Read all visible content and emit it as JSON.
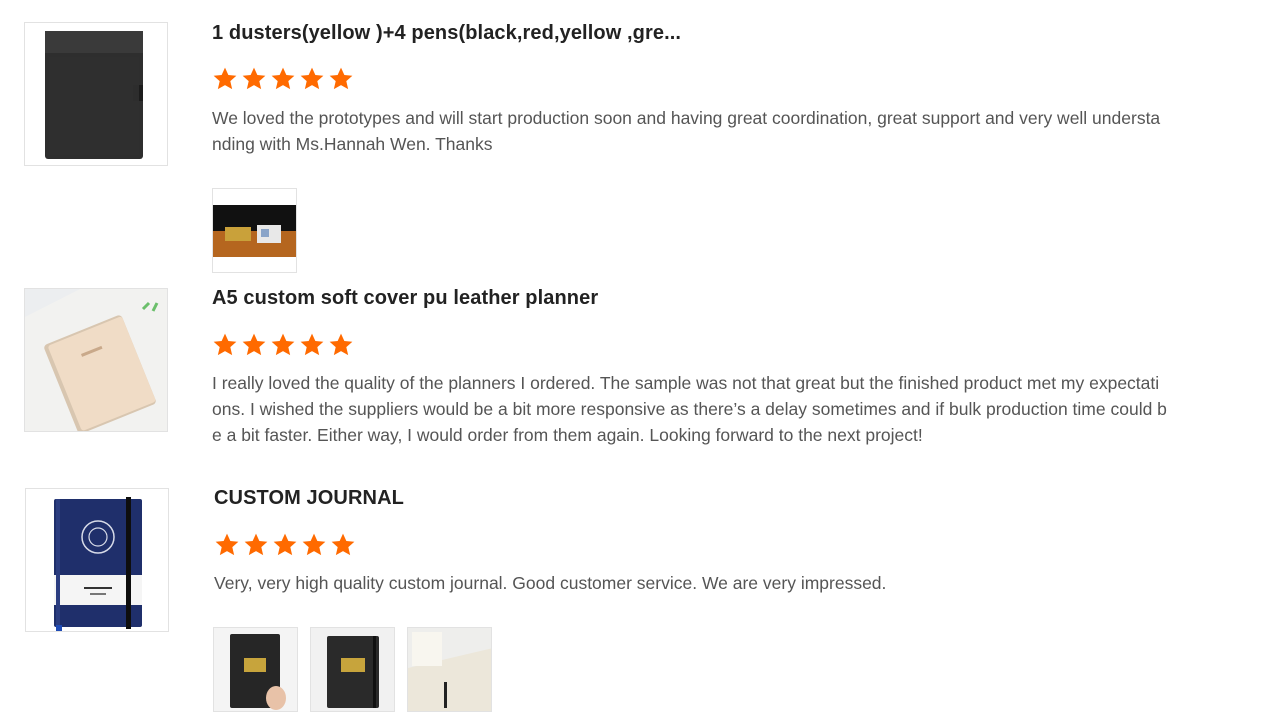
{
  "colors": {
    "star": "#ff6a00",
    "border": "#e2e2e2"
  },
  "reviews": [
    {
      "title": "1 dusters(yellow )+4 pens(black,red,yellow ,gre...",
      "rating": 5,
      "text": "We loved the prototypes and will start production soon and having great coordination, great support and very well understanding with Ms.Hannah Wen. Thanks",
      "thumb_icon": "leather-folder-image",
      "photos": [
        "desk-nameplate-photo"
      ]
    },
    {
      "title": "A5 custom soft cover pu leather planner",
      "rating": 5,
      "text": "I really loved the quality of the planners I ordered. The sample was not that great but the finished product met my expectations. I wished the suppliers would be a bit more responsive as there’s a delay sometimes and if bulk production time could be a bit faster. Either way, I would order from them again. Looking forward to the next project!",
      "thumb_icon": "beige-planner-image",
      "photos": []
    },
    {
      "title": "CUSTOM JOURNAL",
      "rating": 5,
      "text": "Very, very high quality custom journal. Good customer service. We are very impressed.",
      "thumb_icon": "navy-journal-image",
      "photos": [
        "black-journal-photo-1",
        "black-journal-photo-2",
        "open-journal-photo"
      ]
    }
  ]
}
